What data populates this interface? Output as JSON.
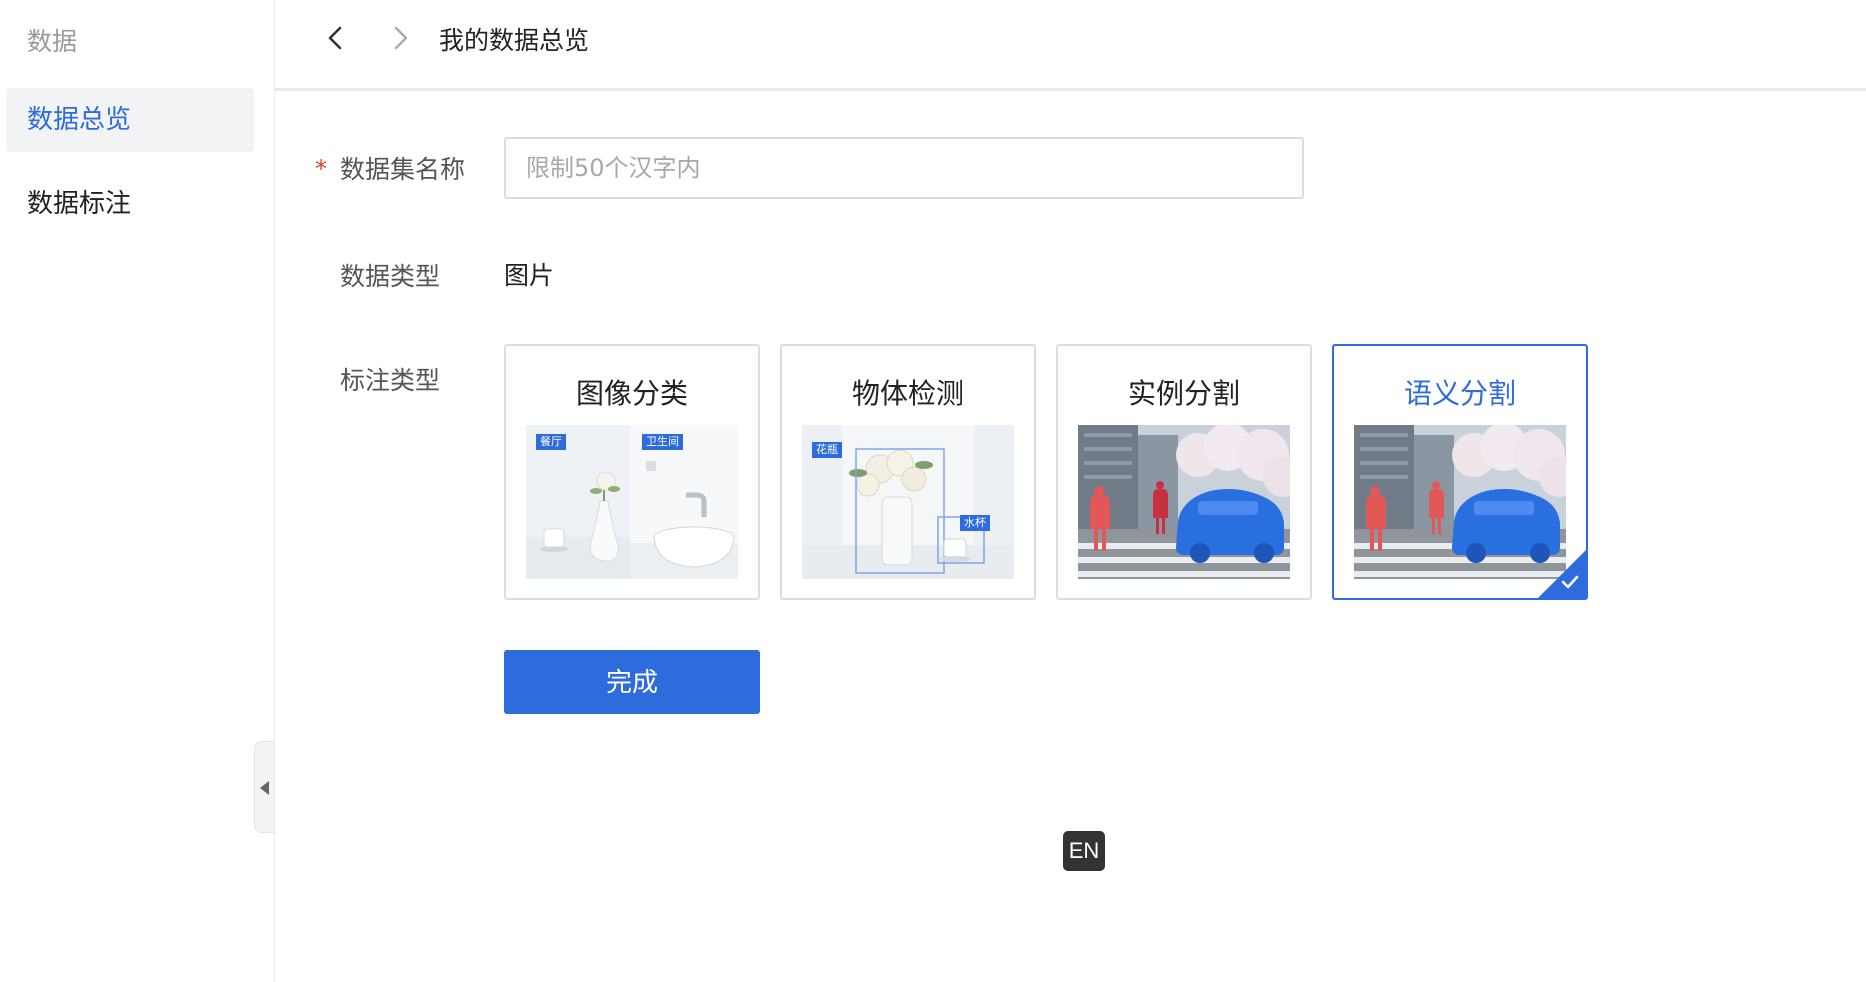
{
  "sidebar": {
    "title": "数据",
    "items": [
      {
        "label": "数据总览",
        "active": true
      },
      {
        "label": "数据标注",
        "active": false
      }
    ]
  },
  "header": {
    "title": "我的数据总览",
    "back_icon": "chevron-left-icon",
    "forward_icon": "chevron-right-icon"
  },
  "form": {
    "name": {
      "required_mark": "*",
      "label": "数据集名称",
      "value": "",
      "placeholder": "限制50个汉字内"
    },
    "data_type": {
      "label": "数据类型",
      "value": "图片"
    },
    "annotation_type": {
      "label": "标注类型",
      "selected": "语义分割",
      "options": [
        {
          "label": "图像分类",
          "tags": [
            "餐厅",
            "卫生间"
          ]
        },
        {
          "label": "物体检测",
          "tags": [
            "花瓶",
            "水杯"
          ]
        },
        {
          "label": "实例分割",
          "tags": []
        },
        {
          "label": "语义分割",
          "tags": []
        }
      ]
    },
    "submit_label": "完成"
  },
  "language_badge": "EN",
  "colors": {
    "accent": "#2e6bdc",
    "required": "#e03e2d",
    "instance_person": "#e04b4b",
    "semantic_car": "#2a6fe0"
  }
}
